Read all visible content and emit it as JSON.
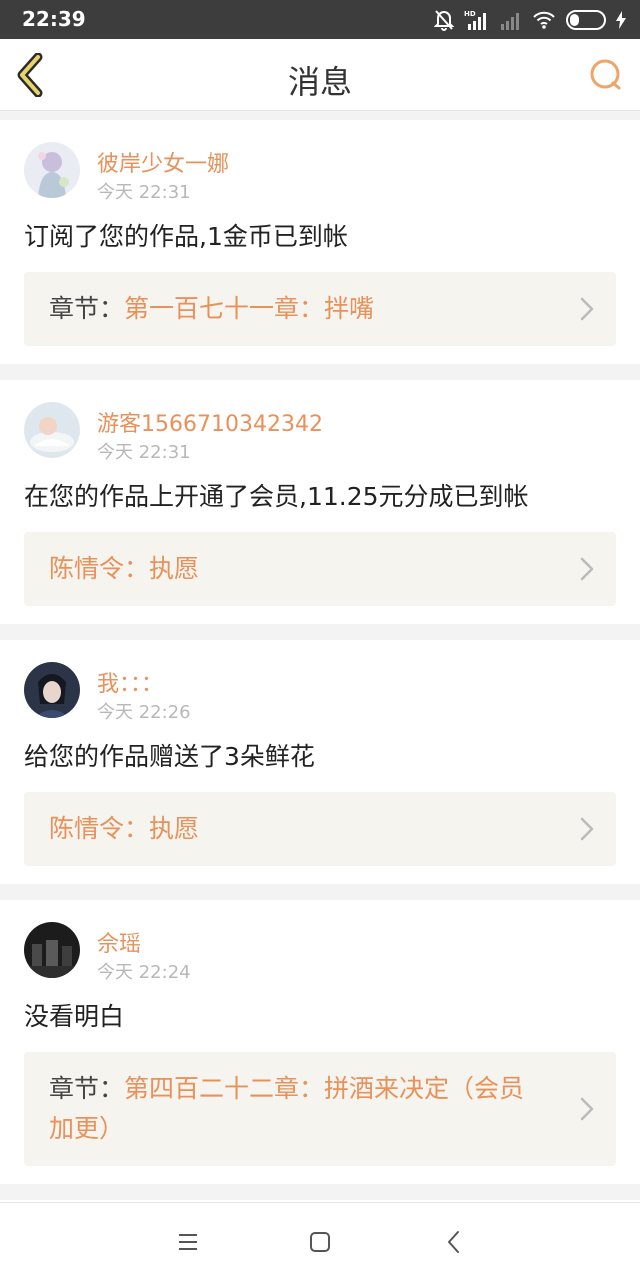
{
  "status_bar": {
    "time": "22:39",
    "battery": "26"
  },
  "header": {
    "title": "消息"
  },
  "messages": [
    {
      "name": "彼岸少女一娜",
      "time": "今天 22:31",
      "content": "订阅了您的作品,1金币已到帐",
      "ref_label": "章节：",
      "ref_title": "第一百七十一章：拌嘴"
    },
    {
      "name": "游客1566710342342",
      "time": "今天 22:31",
      "content": "在您的作品上开通了会员,11.25元分成已到帐",
      "ref_label": "",
      "ref_title": "陈情令：执愿"
    },
    {
      "name": "我：：：",
      "time": "今天 22:26",
      "content": "给您的作品赠送了3朵鲜花",
      "ref_label": "",
      "ref_title": "陈情令：执愿"
    },
    {
      "name": "佘瑶",
      "time": "今天 22:24",
      "content": "没看明白",
      "ref_label": "章节：",
      "ref_title": "第四百二十二章：拼酒来决定（会员加更）"
    }
  ],
  "colors": {
    "accent": "#e8915a",
    "ref_background": "#f5f4ee"
  }
}
